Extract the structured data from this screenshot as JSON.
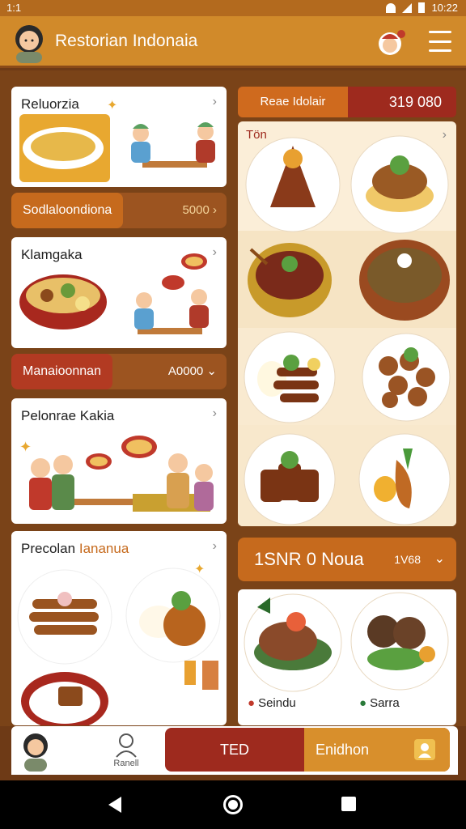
{
  "status": {
    "time_left": "1:1",
    "time_right": "10:22"
  },
  "header": {
    "title": "Restorian Indonaia"
  },
  "cards": [
    {
      "title": "Reluorzia"
    },
    {
      "title": "Klamgaka"
    },
    {
      "title": "Pelonrae Kakia"
    },
    {
      "title": "Precolan",
      "title_accent": "Iananua"
    }
  ],
  "pills": [
    {
      "label": "Sodlaloondiona",
      "value": "5000 ›"
    },
    {
      "label": "Manaioonnan",
      "value": "A0000 ⌄"
    }
  ],
  "right_top": {
    "label": "Reae Idolair",
    "value": "319 080"
  },
  "menu_grid": {
    "title": "Tön"
  },
  "dropdown": {
    "title": "1SNR 0 Noua",
    "value": "1V68",
    "chevron": "⌄"
  },
  "bottom_card": {
    "items": [
      "Seindu",
      "Sarra"
    ]
  },
  "bottom_nav": {
    "profile_label": "Ranell",
    "primary_button": "TED",
    "secondary_button": "Enidhon"
  },
  "colors": {
    "accent_orange": "#d18a2a",
    "accent_red": "#9e2a1e",
    "background": "#7a4318"
  }
}
